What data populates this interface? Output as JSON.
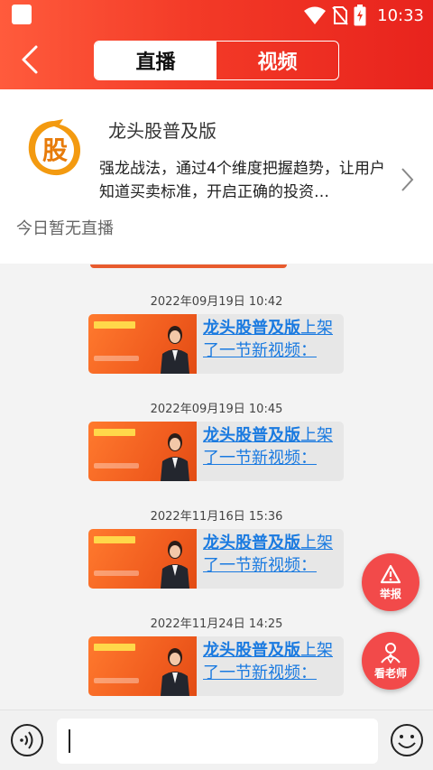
{
  "status_bar": {
    "time": "10:33",
    "icons": [
      "wifi-icon",
      "no-sim-icon",
      "battery-charging-icon"
    ]
  },
  "header": {
    "back_icon": "chevron-left-icon",
    "tabs": [
      {
        "label": "直播",
        "active": true
      },
      {
        "label": "视频",
        "active": false
      }
    ]
  },
  "info_card": {
    "title": "龙头股普及版",
    "description": "强龙战法，通过4个维度把握趋势，让用户知道买卖标准，开启正确的投资…",
    "live_status": "今日暂无直播"
  },
  "feed": {
    "items": [
      {
        "timestamp": "2022年09月19日 10:42",
        "link_text": "龙头股普及版",
        "rest_text": "上架了一节新视频："
      },
      {
        "timestamp": "2022年09月19日 10:45",
        "link_text": "龙头股普及版",
        "rest_text": "上架了一节新视频："
      },
      {
        "timestamp": "2022年11月16日 15:36",
        "link_text": "龙头股普及版",
        "rest_text": "上架了一节新视频："
      },
      {
        "timestamp": "2022年11月24日 14:25",
        "link_text": "龙头股普及版",
        "rest_text": "上架了一节新视频："
      }
    ]
  },
  "fabs": {
    "report_label": "举报",
    "teacher_label": "看老师"
  },
  "composer": {
    "input_value": ""
  },
  "colors": {
    "header_start": "#ff5b3c",
    "header_end": "#e8231d",
    "link": "#1a7ae0",
    "fab": "#f24a4a"
  }
}
